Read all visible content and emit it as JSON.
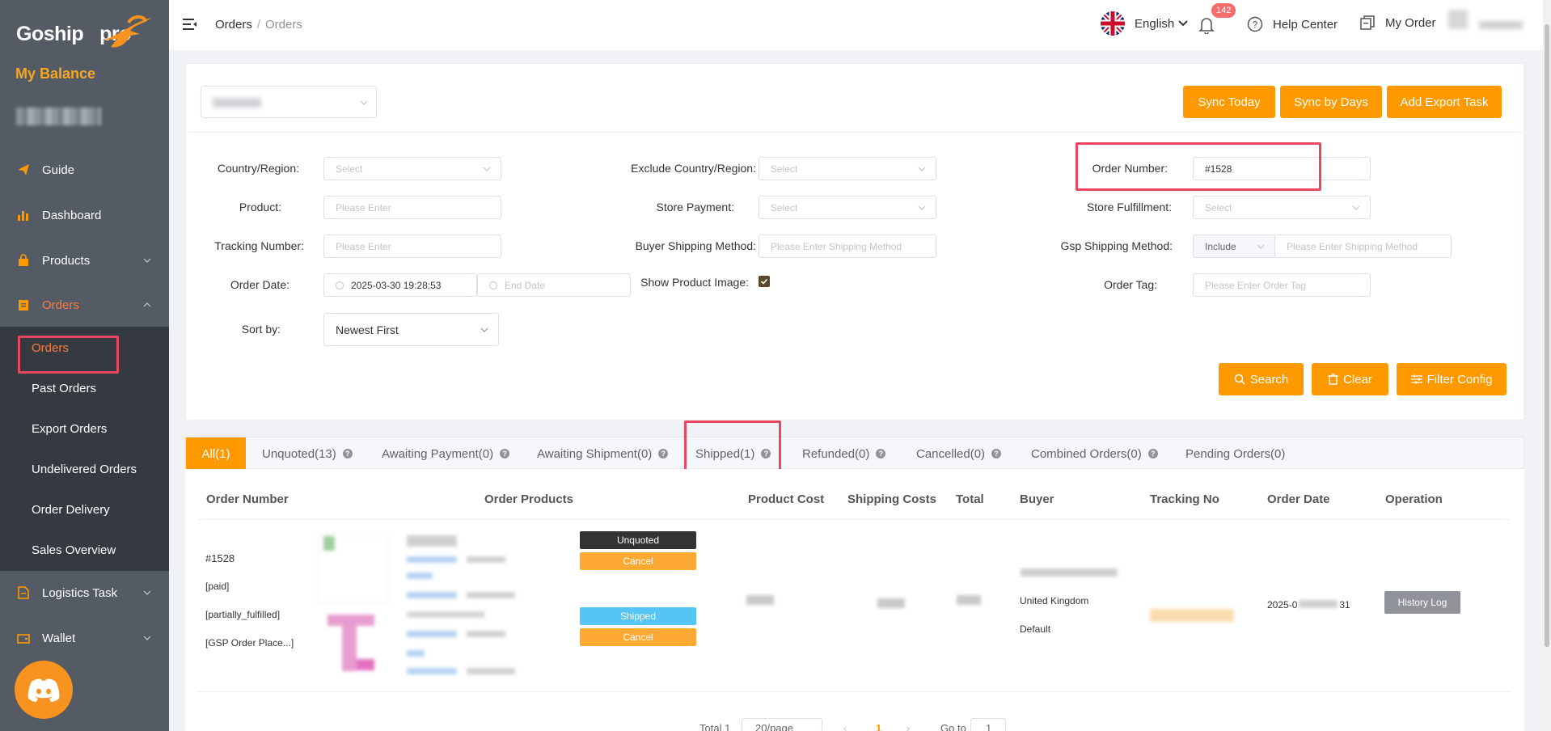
{
  "brand": {
    "logo_text": "Goship",
    "logo_suffix": "pro",
    "balance_label": "My Balance"
  },
  "sidebar": {
    "items": [
      {
        "label": "Guide",
        "icon": "paper-plane-icon"
      },
      {
        "label": "Dashboard",
        "icon": "bar-chart-icon"
      },
      {
        "label": "Products",
        "icon": "shopping-bag-icon"
      },
      {
        "label": "Orders",
        "icon": "clipboard-icon"
      },
      {
        "label": "Logistics Task",
        "icon": "document-icon"
      },
      {
        "label": "Wallet",
        "icon": "wallet-icon"
      }
    ],
    "submenu": [
      "Orders",
      "Past Orders",
      "Export Orders",
      "Undelivered Orders",
      "Order Delivery",
      "Sales Overview"
    ]
  },
  "header": {
    "breadcrumb": [
      "Orders",
      "Orders"
    ],
    "language": "English",
    "notification_count": "142",
    "help": "Help Center",
    "my_order": "My Order"
  },
  "actions": {
    "sync_today": "Sync Today",
    "sync_by_days": "Sync by Days",
    "add_export": "Add Export Task"
  },
  "filters": {
    "country_label": "Country/Region:",
    "country_placeholder": "Select",
    "exclude_label": "Exclude Country/Region:",
    "exclude_placeholder": "Select",
    "order_number_label": "Order Number:",
    "order_number_value": "#1528",
    "product_label": "Product:",
    "product_placeholder": "Please Enter",
    "store_payment_label": "Store Payment:",
    "store_payment_placeholder": "Select",
    "store_fulfillment_label": "Store Fulfillment:",
    "store_fulfillment_placeholder": "Select",
    "tracking_label": "Tracking Number:",
    "tracking_placeholder": "Please Enter",
    "buyer_ship_label": "Buyer Shipping Method:",
    "buyer_ship_placeholder": "Please Enter Shipping Method",
    "gsp_ship_label": "Gsp Shipping Method:",
    "gsp_include": "Include",
    "gsp_ship_placeholder": "Please Enter Shipping Method",
    "order_date_label": "Order Date:",
    "start_date": "2025-03-30 19:28:53",
    "end_date_placeholder": "End Date",
    "show_image_label": "Show Product Image:",
    "show_image_checked": true,
    "order_tag_label": "Order Tag:",
    "order_tag_placeholder": "Please Enter Order Tag",
    "sort_label": "Sort by:",
    "sort_value": "Newest First"
  },
  "filter_buttons": {
    "search": "Search",
    "clear": "Clear",
    "filter_config": "Filter Config"
  },
  "tabs": [
    {
      "label": "All(1)",
      "active": true,
      "help": false
    },
    {
      "label": "Unquoted(13)",
      "help": true
    },
    {
      "label": "Awaiting Payment(0)",
      "help": true
    },
    {
      "label": "Awaiting Shipment(0)",
      "help": true
    },
    {
      "label": "Shipped(1)",
      "help": true
    },
    {
      "label": "Refunded(0)",
      "help": true
    },
    {
      "label": "Cancelled(0)",
      "help": true
    },
    {
      "label": "Combined Orders(0)",
      "help": true
    },
    {
      "label": "Pending Orders(0)",
      "help": false
    }
  ],
  "table": {
    "columns": [
      "Order Number",
      "Order Products",
      "Product Cost",
      "Shipping Costs",
      "Total",
      "Buyer",
      "Tracking No",
      "Order Date",
      "Operation"
    ],
    "row": {
      "order_number": "#1528",
      "tags": [
        "[paid]",
        "[partially_fulfilled]",
        "[GSP Order Place...]"
      ],
      "status_1": "Unquoted",
      "cancel_1": "Cancel",
      "status_2": "Shipped",
      "cancel_2": "Cancel",
      "buyer_country": "United Kingdom",
      "buyer_type": "Default",
      "order_date_start": "2025-0",
      "order_date_end": "31",
      "operation": "History Log"
    }
  },
  "pagination": {
    "total": "Total 1",
    "page_size": "20/page",
    "current_page": "1",
    "goto_label": "Go to",
    "goto_value": "1"
  },
  "colors": {
    "accent": "#ff9900",
    "sidebar_bg": "#545b64",
    "submenu_bg": "#343a40",
    "active_menu": "#ff7a3d",
    "highlight": "#e8475f",
    "shipped": "#55c5f5"
  }
}
